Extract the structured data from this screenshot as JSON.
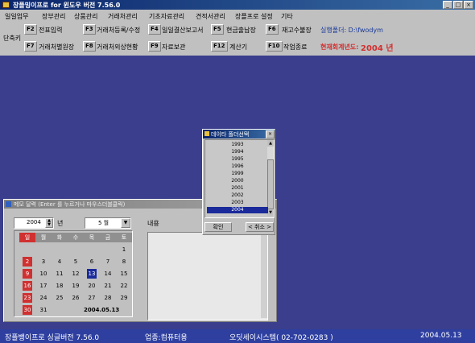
{
  "window": {
    "title": "장플밍이프로 for 윈도우 버전 7.56.0"
  },
  "menubar": [
    "일일업무",
    "장부관리",
    "상품관리",
    "거래처관리",
    "기초자료관리",
    "견적서관리",
    "장플프로 설정",
    "기타"
  ],
  "toolbar": {
    "shortcut_label": "단축키",
    "row1": [
      {
        "key": "F2",
        "label": "전표입력"
      },
      {
        "key": "F3",
        "label": "거래처등록/수정"
      },
      {
        "key": "F4",
        "label": "일일결산보고서"
      },
      {
        "key": "F5",
        "label": "현금출납장"
      },
      {
        "key": "F6",
        "label": "재고수불장"
      }
    ],
    "row2": [
      {
        "key": "F7",
        "label": "거래처별원장"
      },
      {
        "key": "F8",
        "label": "거래처외상현황"
      },
      {
        "key": "F9",
        "label": "자료보관"
      },
      {
        "key": "F12",
        "label": "계산기"
      },
      {
        "key": "F10",
        "label": "작업종료"
      }
    ],
    "folder_text": "실행폴더: D:\\fwodym",
    "fiscal_label": "현재회계년도:",
    "fiscal_year": "2004 년"
  },
  "memo": {
    "title": "메모 달력 (Enter 를 누르거나 마우스더블클릭)",
    "year_value": "2004",
    "year_unit": "년",
    "month_value": "5 월",
    "content_label": "내용",
    "weekdays": [
      "일",
      "월",
      "화",
      "수",
      "목",
      "금",
      "토"
    ],
    "weeks": [
      [
        "",
        "",
        "",
        "",
        "",
        "",
        "1"
      ],
      [
        "2",
        "3",
        "4",
        "5",
        "6",
        "7",
        "8"
      ],
      [
        "9",
        "10",
        "11",
        "12",
        "13",
        "14",
        "15"
      ],
      [
        "16",
        "17",
        "18",
        "19",
        "20",
        "21",
        "22"
      ],
      [
        "23",
        "24",
        "25",
        "26",
        "27",
        "28",
        "29"
      ],
      [
        "30",
        "31",
        "",
        "",
        "",
        "",
        ""
      ]
    ],
    "selected_day": "13",
    "date_display": "2004.05.13"
  },
  "dialog": {
    "title": "데이타 폴더선택",
    "years": [
      "1993",
      "1994",
      "1995",
      "1996",
      "1999",
      "2000",
      "2001",
      "2002",
      "2003",
      "2004"
    ],
    "selected_year": "2004",
    "ok_label": "확인",
    "cancel_label": "< 취소 >"
  },
  "statusbar": {
    "product": "장플뱅이프로 싱글버전 7.56.0",
    "business": "업종:컴퓨터용",
    "company": "오딧세이시스템( 02-702-0283 )",
    "date": "2004.05.13"
  },
  "colors": {
    "desktop": "#3a3e8c",
    "statusbar": "#2e3fa0",
    "accent_red": "#d03030",
    "selected": "#1a2a9a"
  }
}
